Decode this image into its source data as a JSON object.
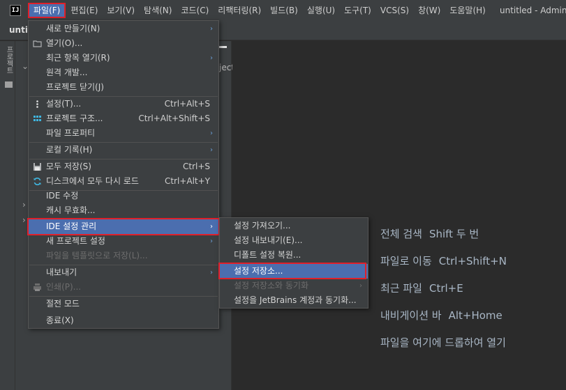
{
  "window_title": "untitled - Adminis",
  "tab_title": "untit",
  "menubar": [
    "파일(F)",
    "편집(E)",
    "보기(V)",
    "탐색(N)",
    "코드(C)",
    "리팩터링(R)",
    "빌드(B)",
    "실행(U)",
    "도구(T)",
    "VCS(S)",
    "창(W)",
    "도움말(H)"
  ],
  "side_label": "프로젝트",
  "project_fragment": "ject",
  "file_menu": [
    {
      "label": "새로 만들기(N)",
      "shortcut": "",
      "arrow": true
    },
    {
      "label": "열기(O)...",
      "shortcut": "",
      "arrow": false,
      "icon": "folder-icon"
    },
    {
      "label": "최근 항목 열기(R)",
      "shortcut": "",
      "arrow": true
    },
    {
      "label": "원격 개발...",
      "shortcut": "",
      "arrow": false
    },
    {
      "label": "프로젝트 닫기(J)",
      "shortcut": "",
      "arrow": false
    },
    {
      "label": "설정(T)...",
      "shortcut": "Ctrl+Alt+S",
      "arrow": false,
      "icon": "settings-icon"
    },
    {
      "label": "프로젝트 구조...",
      "shortcut": "Ctrl+Alt+Shift+S",
      "arrow": false,
      "icon": "project-structure-icon"
    },
    {
      "label": "파일 프로퍼티",
      "shortcut": "",
      "arrow": true
    },
    {
      "label": "로컬 기록(H)",
      "shortcut": "",
      "arrow": true
    },
    {
      "label": "모두 저장(S)",
      "shortcut": "Ctrl+S",
      "arrow": false,
      "icon": "save-icon"
    },
    {
      "label": "디스크에서 모두 다시 로드",
      "shortcut": "Ctrl+Alt+Y",
      "arrow": false,
      "icon": "reload-icon"
    },
    {
      "label": "IDE 수정",
      "shortcut": "",
      "arrow": false
    },
    {
      "label": "캐시 무효화...",
      "shortcut": "",
      "arrow": false
    },
    {
      "label": "IDE 설정 관리",
      "shortcut": "",
      "arrow": true
    },
    {
      "label": "새 프로젝트 설정",
      "shortcut": "",
      "arrow": true
    },
    {
      "label": "파일을 템플릿으로 저장(L)...",
      "shortcut": "",
      "arrow": false
    },
    {
      "label": "내보내기",
      "shortcut": "",
      "arrow": true
    },
    {
      "label": "인쇄(P)...",
      "shortcut": "",
      "arrow": false,
      "icon": "print-icon"
    },
    {
      "label": "절전 모드",
      "shortcut": "",
      "arrow": false
    },
    {
      "label": "종료(X)",
      "shortcut": "",
      "arrow": false
    }
  ],
  "submenu": [
    {
      "label": "설정 가져오기...",
      "arrow": false
    },
    {
      "label": "설정 내보내기(E)...",
      "arrow": false
    },
    {
      "label": "디폴트 설정 복원...",
      "arrow": false
    },
    {
      "label": "설정 저장소...",
      "arrow": false
    },
    {
      "label": "설정 저장소와 동기화",
      "arrow": true
    },
    {
      "label": "설정을 JetBrains 계정과 동기화...",
      "arrow": false
    }
  ],
  "hints": [
    {
      "label": "전체 검색",
      "keys": "Shift 두 번"
    },
    {
      "label": "파일로 이동",
      "keys": "Ctrl+Shift+N"
    },
    {
      "label": "최근 파일",
      "keys": "Ctrl+E"
    },
    {
      "label": "내비게이션 바",
      "keys": "Alt+Home"
    },
    {
      "label": "파일을 여기에 드롭하여 열기",
      "keys": ""
    }
  ]
}
